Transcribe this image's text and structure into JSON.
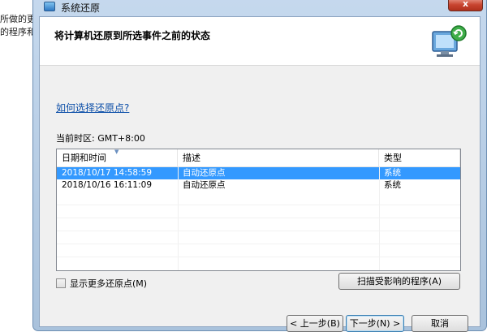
{
  "background": {
    "lines": [
      "所做的更",
      "的程序和"
    ]
  },
  "window": {
    "title": "系统还原",
    "close_label": "x"
  },
  "header": {
    "title": "将计算机还原到所选事件之前的状态"
  },
  "help_link": "如何选择还原点?",
  "timezone": "当前时区: GMT+8:00",
  "list": {
    "columns": [
      "日期和时间",
      "描述",
      "类型"
    ],
    "rows": [
      {
        "date": "2018/10/17 14:58:59",
        "description": "自动还原点",
        "type": "系统",
        "selected": true
      },
      {
        "date": "2018/10/16 16:11:09",
        "description": "自动还原点",
        "type": "系统",
        "selected": false
      }
    ]
  },
  "show_more_label": "显示更多还原点(M)",
  "scan_button": "扫描受影响的程序(A)",
  "buttons": {
    "back": "< 上一步(B)",
    "next": "下一步(N) >",
    "cancel": "取消"
  },
  "colors": {
    "selection": "#3399ff",
    "link": "#0b4ea8",
    "title_bar": "#b7cde6"
  }
}
